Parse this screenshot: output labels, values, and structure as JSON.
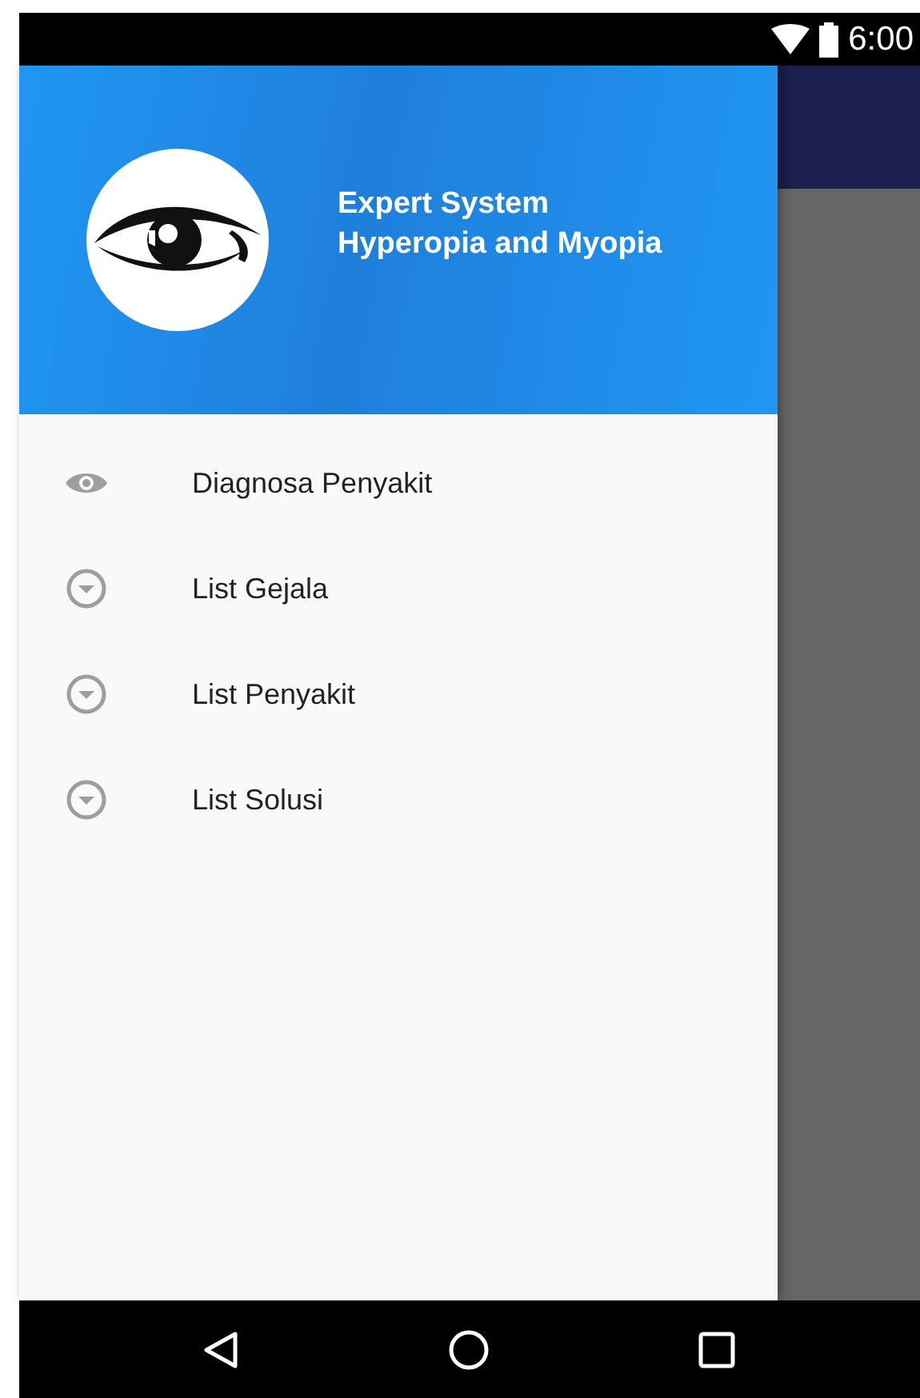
{
  "status_bar": {
    "time": "6:00"
  },
  "drawer": {
    "header": {
      "title_lines": [
        "Expert System",
        "Hyperopia and Myopia"
      ]
    },
    "items": [
      {
        "label": "Diagnosa Penyakit",
        "kind": "eye"
      },
      {
        "label": "List Gejala",
        "kind": "dropdown"
      },
      {
        "label": "List Penyakit",
        "kind": "dropdown"
      },
      {
        "label": "List Solusi",
        "kind": "dropdown"
      }
    ]
  }
}
